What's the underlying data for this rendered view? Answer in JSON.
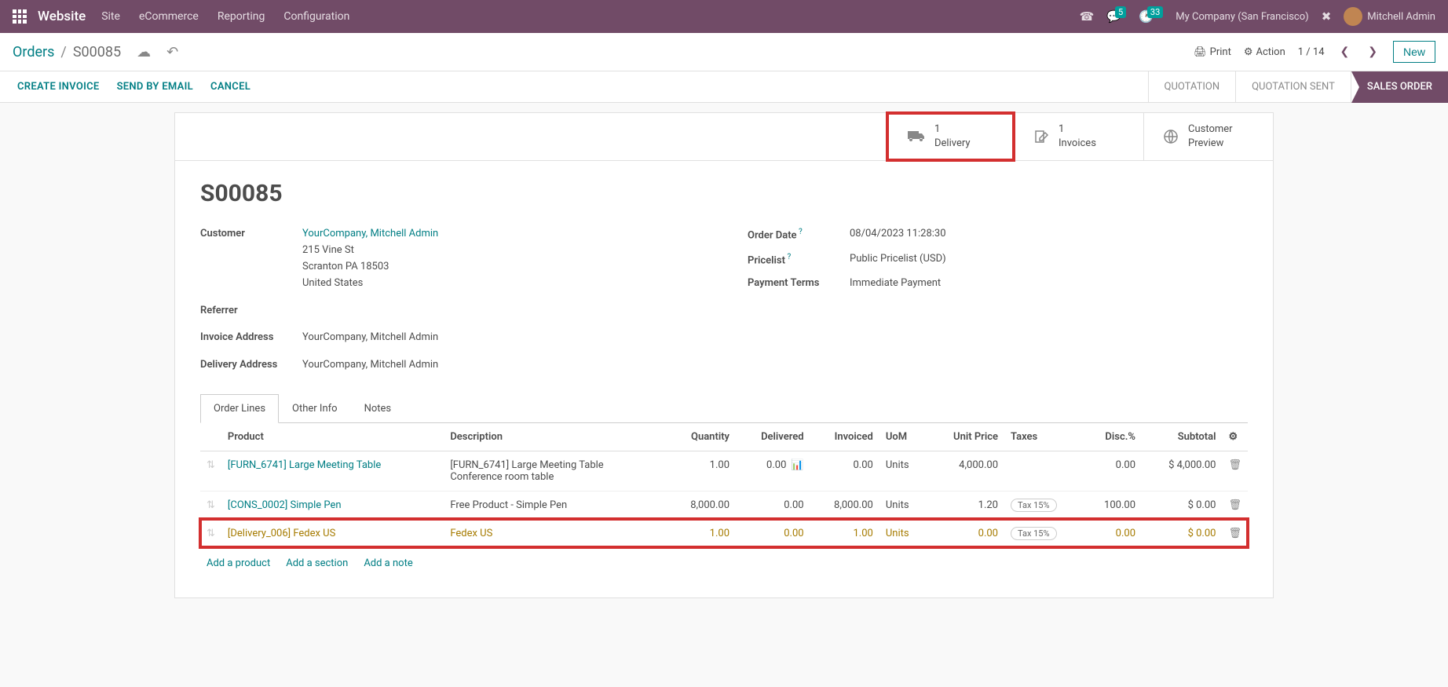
{
  "nav": {
    "brand": "Website",
    "items": [
      "Site",
      "eCommerce",
      "Reporting",
      "Configuration"
    ],
    "msg_badge": "5",
    "clock_badge": "33",
    "company": "My Company (San Francisco)",
    "user": "Mitchell Admin"
  },
  "breadcrumb": {
    "parent": "Orders",
    "current": "S00085"
  },
  "control": {
    "print": "Print",
    "action": "Action",
    "pager": "1 / 14",
    "new": "New"
  },
  "actions": {
    "create_invoice": "CREATE INVOICE",
    "send_email": "SEND BY EMAIL",
    "cancel": "CANCEL"
  },
  "status": {
    "quotation": "QUOTATION",
    "quotation_sent": "QUOTATION SENT",
    "sales_order": "SALES ORDER"
  },
  "stats": {
    "delivery": {
      "count": "1",
      "label": "Delivery"
    },
    "invoices": {
      "count": "1",
      "label": "Invoices"
    },
    "preview": {
      "line1": "Customer",
      "line2": "Preview"
    }
  },
  "record": {
    "title": "S00085",
    "labels": {
      "customer": "Customer",
      "referrer": "Referrer",
      "invoice_addr": "Invoice Address",
      "delivery_addr": "Delivery Address",
      "order_date": "Order Date",
      "pricelist": "Pricelist",
      "payment_terms": "Payment Terms"
    },
    "customer_name": "YourCompany, Mitchell Admin",
    "customer_addr1": "215 Vine St",
    "customer_addr2": "Scranton PA 18503",
    "customer_addr3": "United States",
    "invoice_addr": "YourCompany, Mitchell Admin",
    "delivery_addr": "YourCompany, Mitchell Admin",
    "order_date": "08/04/2023 11:28:30",
    "pricelist": "Public Pricelist (USD)",
    "payment_terms": "Immediate Payment"
  },
  "tabs": {
    "order_lines": "Order Lines",
    "other_info": "Other Info",
    "notes": "Notes"
  },
  "table": {
    "headers": {
      "product": "Product",
      "description": "Description",
      "quantity": "Quantity",
      "delivered": "Delivered",
      "invoiced": "Invoiced",
      "uom": "UoM",
      "unit_price": "Unit Price",
      "taxes": "Taxes",
      "disc": "Disc.%",
      "subtotal": "Subtotal"
    },
    "rows": [
      {
        "product": "[FURN_6741] Large Meeting Table",
        "desc1": "[FURN_6741] Large Meeting Table",
        "desc2": "Conference room table",
        "qty": "1.00",
        "delivered": "0.00",
        "invoiced": "0.00",
        "uom": "Units",
        "price": "4,000.00",
        "tax": "",
        "disc": "0.00",
        "subtotal": "$ 4,000.00",
        "has_chart": true
      },
      {
        "product": "[CONS_0002] Simple Pen",
        "desc1": "Free Product - Simple Pen",
        "desc2": "",
        "qty": "8,000.00",
        "delivered": "0.00",
        "invoiced": "8,000.00",
        "uom": "Units",
        "price": "1.20",
        "tax": "Tax 15%",
        "disc": "100.00",
        "subtotal": "$ 0.00",
        "has_chart": false
      },
      {
        "product": "[Delivery_006] Fedex US",
        "desc1": "Fedex US",
        "desc2": "",
        "qty": "1.00",
        "delivered": "0.00",
        "invoiced": "1.00",
        "uom": "Units",
        "price": "0.00",
        "tax": "Tax 15%",
        "disc": "0.00",
        "subtotal": "$ 0.00",
        "has_chart": false
      }
    ],
    "add": {
      "product": "Add a product",
      "section": "Add a section",
      "note": "Add a note"
    }
  }
}
